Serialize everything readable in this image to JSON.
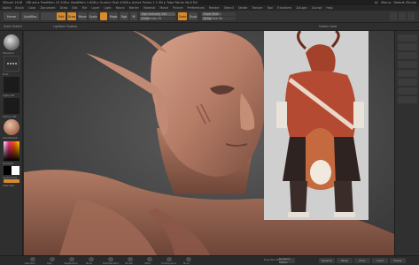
{
  "app": {
    "title": "ZBrush 2018",
    "title_extra": "ZBrush ▸ FreeMem 23.1GB ▸ UsedMem 1.6GB ▸ Scratch Disk 43GB ▸ Active Points 2.1 Mil ▸ Total Points 56.8 Mil",
    "title_right": [
      "AC",
      "Menus",
      "Default ZScript"
    ]
  },
  "menu": {
    "items": [
      "Alpha",
      "Brush",
      "Color",
      "Document",
      "Draw",
      "Edit",
      "File",
      "Layer",
      "Light",
      "Macro",
      "Marker",
      "Material",
      "Movie",
      "Picture",
      "Preferences",
      "Render",
      "Stencil",
      "Stroke",
      "Texture",
      "Tool",
      "Transform",
      "Zplugin",
      "Zscript",
      "Help"
    ]
  },
  "toolbar": {
    "home_label": "Home",
    "lightbox_label": "LightBox",
    "edit_label": "Edit",
    "draw_label": "Draw",
    "move_label": "Move",
    "scale_label": "Scale",
    "rotate_label": "Rotate",
    "mrgb_label": "Mrgb",
    "rgb_label": "Rgb",
    "m_label": "M",
    "zadd_label": "Zadd",
    "zsub_label": "Zsub",
    "focal_label": "Focal Shift 0",
    "draw_size_label": "Draw Size 64",
    "rgb_intensity_label": "Rgb Intensity 100",
    "z_intensity_label": "Z Intensity 25",
    "focal_value": 0.5,
    "draw_size_value": 0.3,
    "rgb_intensity_value": 1.0,
    "z_intensity_value": 0.25
  },
  "subbar": {
    "left_label": "Quick Sketch",
    "mid_label": "Lightbox Projects",
    "right_label": "Subdiv Level"
  },
  "leftpanel": {
    "brush_label": "Standard",
    "stroke_label": "Dots",
    "alpha_label": "Alpha Off",
    "texture_label": "Texture Off",
    "material_label": "SkinShade4",
    "gradient_label": "Gradient",
    "switch_label": "SwitchColor",
    "alternate_label": "Alternate"
  },
  "bottom": {
    "icons": [
      "Standard",
      "Clay",
      "ClayBuildup",
      "Move",
      "DamStandard",
      "hPolish",
      "Inflat",
      "TrimDynamic",
      "Pinch"
    ],
    "right_buttons": [
      "Dynamic",
      "Persp",
      "Floor",
      "Local",
      "Frame"
    ],
    "mid_label": "Projection Master",
    "dyn_label": "Dynamic Subdiv"
  },
  "colors": {
    "accent": "#d98b2b",
    "skin": "#c08a73"
  }
}
